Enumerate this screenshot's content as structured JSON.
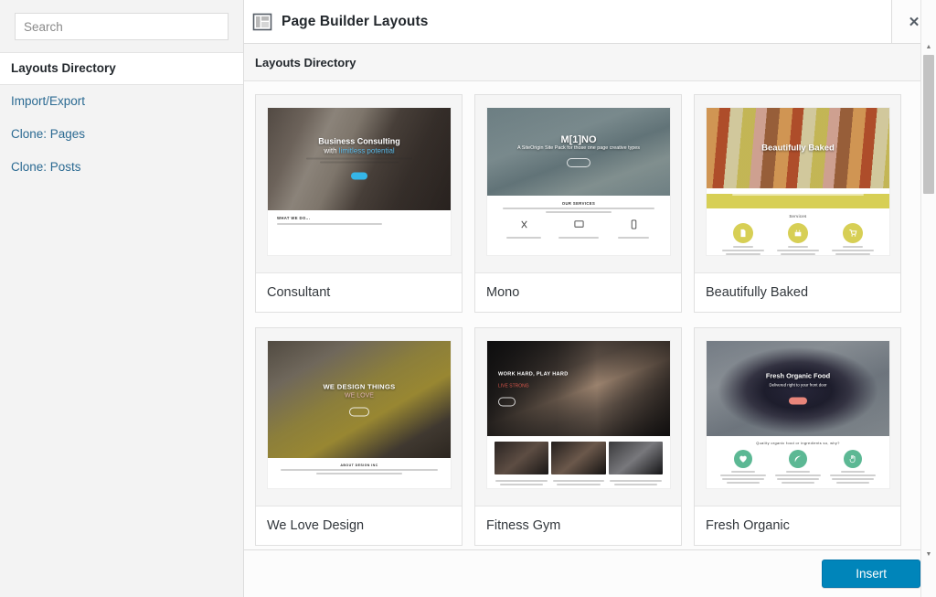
{
  "sidebar": {
    "search": {
      "placeholder": "Search",
      "value": ""
    },
    "items": [
      {
        "label": "Layouts Directory",
        "active": true
      },
      {
        "label": "Import/Export",
        "active": false
      },
      {
        "label": "Clone: Pages",
        "active": false
      },
      {
        "label": "Clone: Posts",
        "active": false
      }
    ]
  },
  "header": {
    "title": "Page Builder Layouts",
    "icon": "layout-icon",
    "close_label": "✕"
  },
  "content": {
    "section_title": "Layouts Directory",
    "cards": [
      {
        "title": "Consultant",
        "hero_line1": "Business Consulting",
        "hero_line2_a": "with ",
        "hero_line2_b": "limitless potential",
        "section_heading": "WHAT WE DO..."
      },
      {
        "title": "Mono",
        "hero_line1": "M[1]NO",
        "hero_line2_a": "A SiteOrigin Site Pack for those one page ",
        "hero_line2_b": "creative types",
        "section_heading": "OUR SERVICES"
      },
      {
        "title": "Beautifully Baked",
        "hero_line1": "Beautifully Baked",
        "section_heading": "Services"
      },
      {
        "title": "We Love Design",
        "hero_line1": "WE DESIGN THINGS",
        "hero_line2_b": "WE LOVE",
        "section_heading": "ABOUT DESIGN INC"
      },
      {
        "title": "Fitness Gym",
        "hero_line1": "WORK HARD, PLAY HARD",
        "hero_line2_b": "LIVE STRONG"
      },
      {
        "title": "Fresh Organic",
        "hero_line1": "Fresh Organic Food",
        "hero_line2_b": "Delivered right to your front door",
        "section_heading": "Quality organic food or ingredients so, why?"
      }
    ]
  },
  "footer": {
    "insert_label": "Insert"
  },
  "colors": {
    "accent_blue": "#0085ba",
    "link_blue": "#2b6a92",
    "baked_yellow": "#d7cf55",
    "fitness_red": "#d9564b",
    "organic_green": "#5cb894",
    "consultant_blue": "#5ab9e8"
  },
  "scrollbar": {
    "up": "▲",
    "down": "▼"
  }
}
